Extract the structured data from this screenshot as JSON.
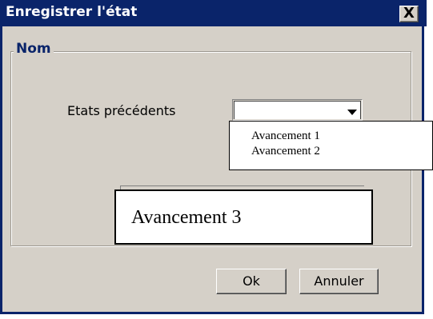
{
  "window": {
    "title": "Enregistrer l'état",
    "close_glyph": "X"
  },
  "group": {
    "legend": "Nom"
  },
  "states_field": {
    "label": "Etats précédents",
    "selected_value": ""
  },
  "dropdown": {
    "options": [
      "Avancement 1",
      "Avancement 2"
    ]
  },
  "callout": {
    "text": "Avancement 3"
  },
  "buttons": {
    "ok": "Ok",
    "cancel": "Annuler"
  },
  "colors": {
    "titlebar": "#0a246a",
    "dialog_bg": "#d5d0c8",
    "legend_text": "#0a246a"
  }
}
